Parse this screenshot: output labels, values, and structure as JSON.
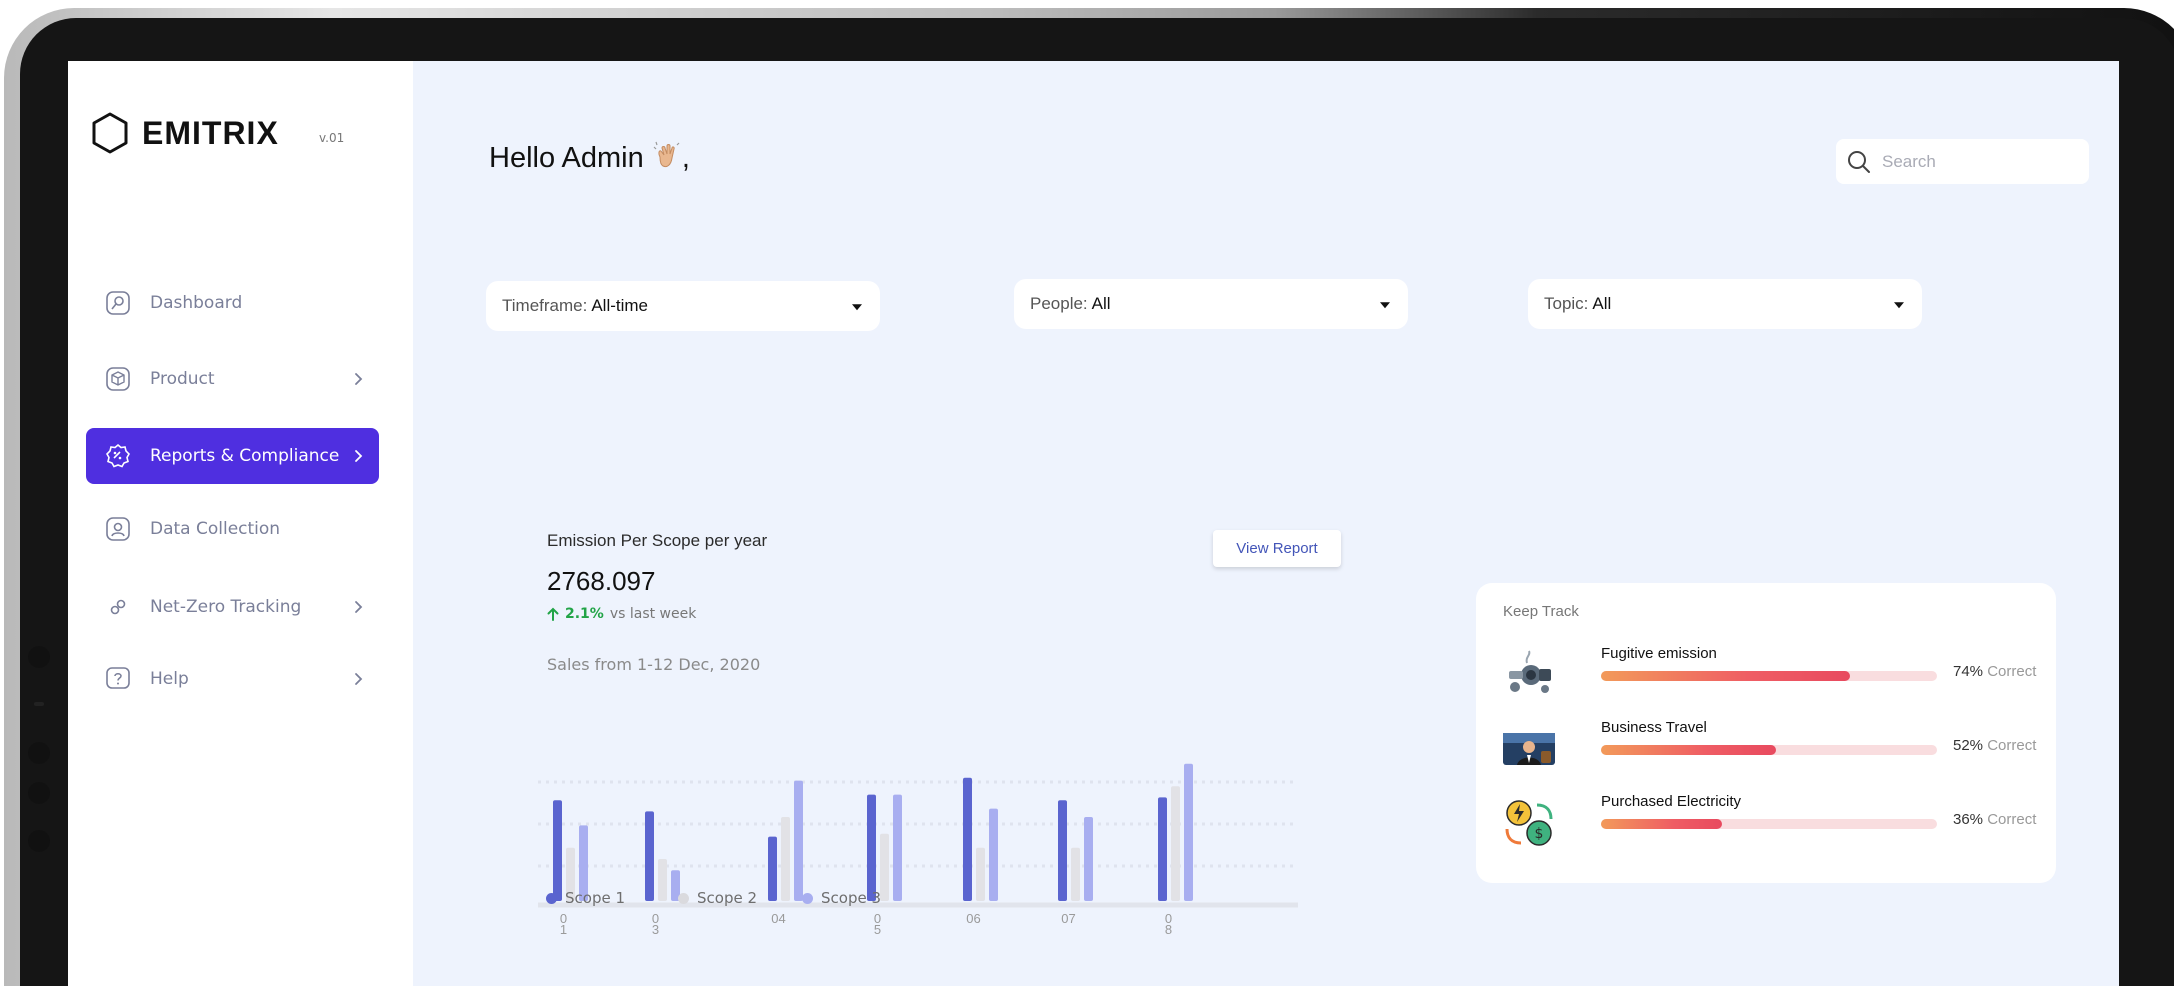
{
  "app": {
    "logo_text": "EMITRIX",
    "version": "v.01"
  },
  "sidebar": {
    "items": [
      {
        "label": "Dashboard",
        "icon": "dashboard-icon",
        "has_chevron": false,
        "active": false
      },
      {
        "label": "Product",
        "icon": "box-icon",
        "has_chevron": true,
        "active": false
      },
      {
        "label": "Reports & Compliance",
        "icon": "badge-check-icon",
        "has_chevron": true,
        "active": true
      },
      {
        "label": "Data Collection",
        "icon": "user-icon",
        "has_chevron": false,
        "active": false
      },
      {
        "label": "Net-Zero Tracking",
        "icon": "link-icon",
        "has_chevron": true,
        "active": false
      },
      {
        "label": "Help",
        "icon": "help-icon",
        "has_chevron": true,
        "active": false
      }
    ]
  },
  "header": {
    "greeting": "Hello Admin",
    "greeting_suffix": ",",
    "search_placeholder": "Search"
  },
  "filters": [
    {
      "label": "Timeframe:",
      "value": "All-time"
    },
    {
      "label": "People:",
      "value": "All"
    },
    {
      "label": "Topic:",
      "value": "All"
    }
  ],
  "emissions": {
    "title": "Emission Per Scope per year",
    "total": "2768.097",
    "change_pct": "2.1%",
    "change_label": "vs last week",
    "subtitle": "Sales from 1-12 Dec, 2020",
    "view_report_label": "View Report"
  },
  "chart_data": {
    "type": "bar",
    "categories": [
      "0\n1",
      "0\n3",
      "04",
      "0\n5",
      "06",
      "07",
      "0\n8"
    ],
    "series": [
      {
        "name": "Scope 1",
        "values": [
          72,
          64,
          46,
          76,
          88,
          72,
          74
        ]
      },
      {
        "name": "Scope 2",
        "values": [
          38,
          30,
          60,
          48,
          38,
          38,
          82
        ]
      },
      {
        "name": "Scope 3",
        "values": [
          54,
          22,
          86,
          76,
          66,
          60,
          98
        ]
      }
    ],
    "colors": {
      "Scope 1": "#5a64cf",
      "Scope 2": "#e2e2e6",
      "Scope 3": "#a8aef0"
    },
    "ylim": [
      0,
      100
    ],
    "grid": true,
    "legend": "bottom-left"
  },
  "track": {
    "title": "Keep Track",
    "correct_label": "Correct",
    "items": [
      {
        "name": "Fugitive emission",
        "percent": 74,
        "percent_label": "74%",
        "icon": "emission-machine-icon"
      },
      {
        "name": "Business Travel",
        "percent": 52,
        "percent_label": "52%",
        "icon": "business-traveler-icon"
      },
      {
        "name": "Purchased Electricity",
        "percent": 36,
        "percent_label": "36%",
        "icon": "electricity-money-icon"
      }
    ]
  }
}
